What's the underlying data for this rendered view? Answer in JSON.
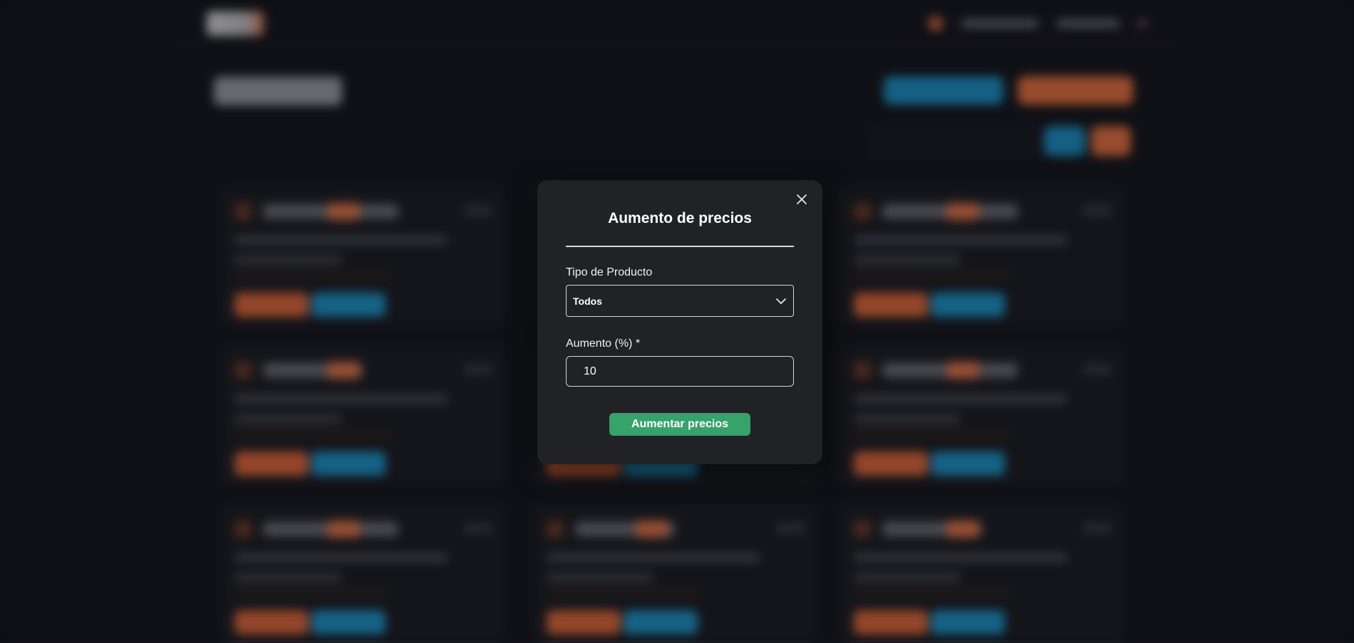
{
  "modal": {
    "title": "Aumento de precios",
    "product_type_label": "Tipo de Producto",
    "product_type_value": "Todos",
    "increase_label": "Aumento (%) *",
    "increase_value": "10",
    "submit_label": "Aumentar precios"
  },
  "colors": {
    "modal_bg": "#212226",
    "submit_green": "#35a36a",
    "accent_orange": "#e0673b",
    "accent_blue": "#1d93c9"
  },
  "icons": {
    "close": "close-icon",
    "select": "chevron-down-icon"
  }
}
